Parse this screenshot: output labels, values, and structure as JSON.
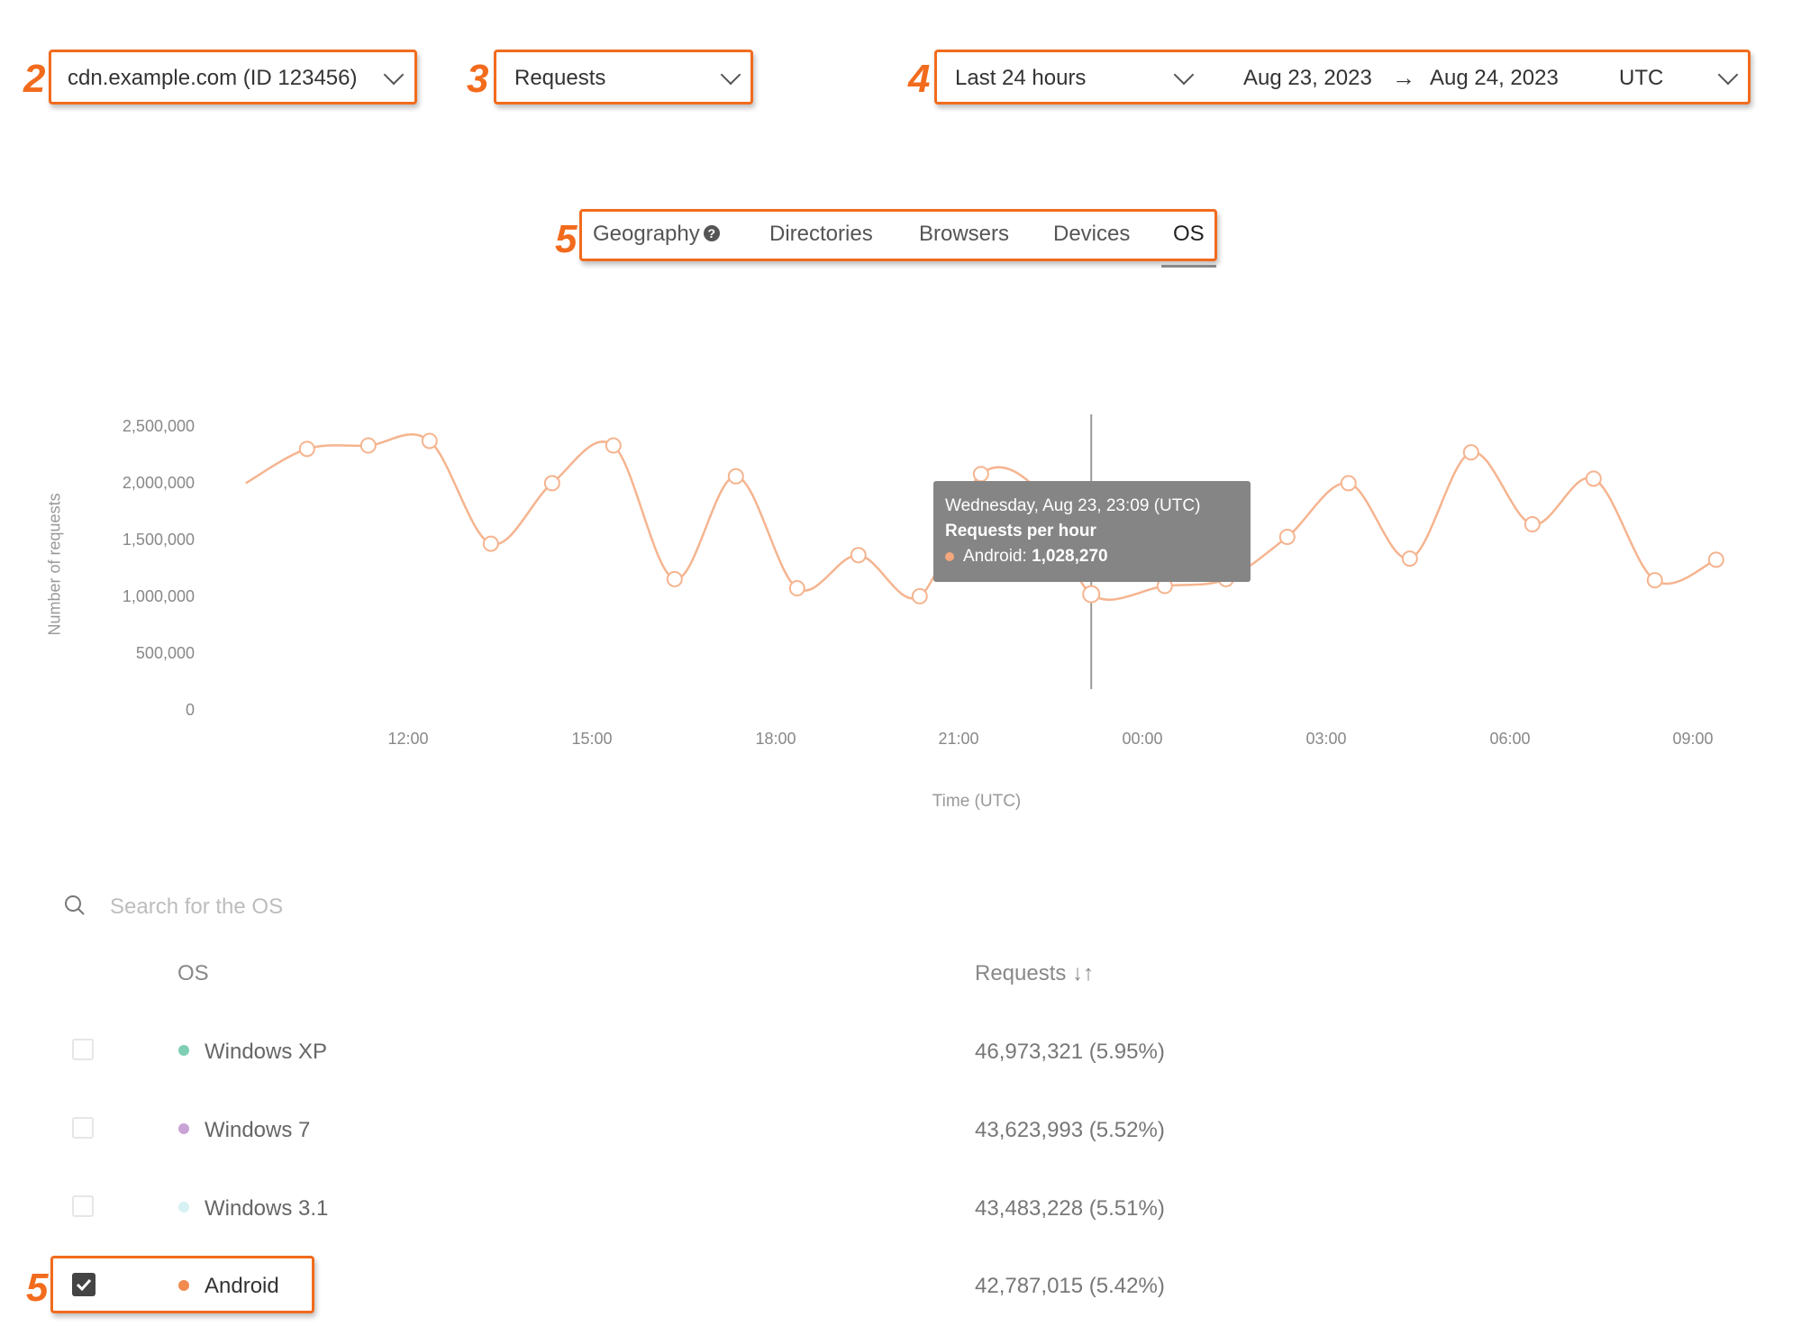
{
  "markers": {
    "zone": "2",
    "metric": "3",
    "time": "4",
    "tabs": "5",
    "row": "5"
  },
  "zone_select": {
    "value": "cdn.example.com (ID 123456)"
  },
  "metric_select": {
    "value": "Requests"
  },
  "time_range": {
    "preset": "Last 24 hours",
    "start": "Aug 23, 2023",
    "arrow": "→",
    "end": "Aug 24, 2023",
    "timezone": "UTC"
  },
  "tabs": [
    {
      "label": "Geography",
      "help_icon": "question-circle-icon"
    },
    {
      "label": "Directories"
    },
    {
      "label": "Browsers"
    },
    {
      "label": "Devices"
    },
    {
      "label": "OS",
      "active": true
    }
  ],
  "chart_data": {
    "type": "line",
    "xlabel": "Time (UTC)",
    "ylabel": "Number of requests",
    "ylim": [
      0,
      2500000
    ],
    "yticks": [
      "2,500,000",
      "2,000,000",
      "1,500,000",
      "1,000,000",
      "500,000",
      "0"
    ],
    "xticks": [
      "12:00",
      "15:00",
      "18:00",
      "21:00",
      "00:00",
      "03:00",
      "06:00",
      "09:00"
    ],
    "series": [
      {
        "name": "Android",
        "color": "#f5b48f",
        "x": [
          "Aug 23 09:21",
          "Aug 23 10:21",
          "Aug 23 11:21",
          "Aug 23 12:21",
          "Aug 23 13:21",
          "Aug 23 14:21",
          "Aug 23 15:21",
          "Aug 23 16:21",
          "Aug 23 17:21",
          "Aug 23 18:21",
          "Aug 23 19:21",
          "Aug 23 20:21",
          "Aug 23 21:21",
          "Aug 23 22:21",
          "Aug 23 23:09",
          "Aug 24 00:21",
          "Aug 24 01:21",
          "Aug 24 02:21",
          "Aug 24 03:21",
          "Aug 24 04:21",
          "Aug 24 05:21",
          "Aug 24 06:21",
          "Aug 24 07:21",
          "Aug 24 08:21",
          "Aug 24 09:21"
        ],
        "values": [
          2000000,
          2300000,
          2330000,
          2370000,
          1470000,
          2000000,
          2330000,
          1160000,
          2060000,
          1080000,
          1370000,
          1010000,
          2080000,
          1900000,
          1028270,
          1100000,
          1160000,
          1530000,
          2000000,
          1340000,
          2270000,
          1640000,
          2040000,
          1150000,
          1330000
        ]
      }
    ]
  },
  "tooltip": {
    "title": "Wednesday, Aug 23, 23:09 (UTC)",
    "metric": "Requests per hour",
    "series_label": "Android:",
    "value": "1,028,270"
  },
  "search": {
    "placeholder": "Search for the OS",
    "icon": "search-icon"
  },
  "table": {
    "headers": {
      "name": "OS",
      "requests": "Requests ↓↑"
    },
    "rows": [
      {
        "name": "Windows XP",
        "value": "46,973,321 (5.95%)",
        "color": "#7fcfb5",
        "checked": false
      },
      {
        "name": "Windows 7",
        "value": "43,623,993 (5.52%)",
        "color": "#c9a3d6",
        "checked": false
      },
      {
        "name": "Windows 3.1",
        "value": "43,483,228 (5.51%)",
        "color": "#d7f1f4",
        "checked": false
      },
      {
        "name": "Android",
        "value": "42,787,015 (5.42%)",
        "color": "#f28b50",
        "checked": true
      }
    ]
  }
}
